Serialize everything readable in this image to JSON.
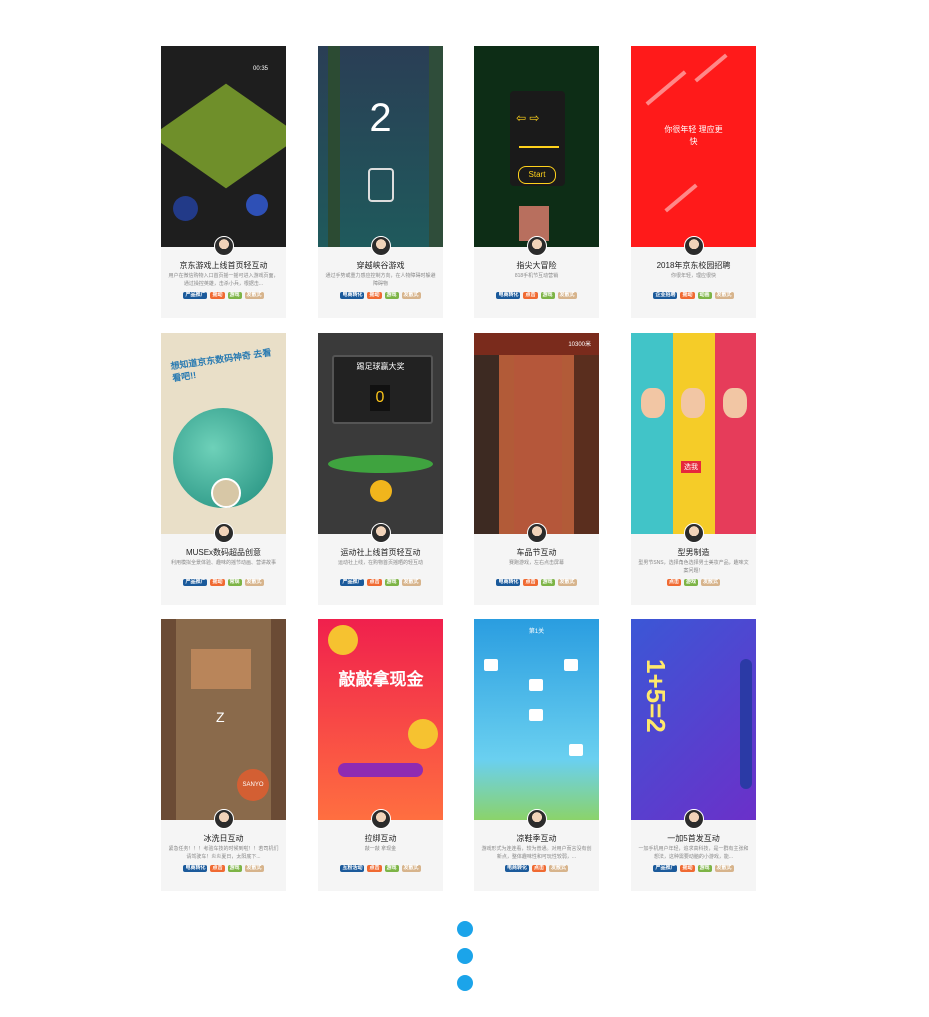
{
  "cards": [
    {
      "title": "京东游戏上线首页轻互动",
      "desc": "用户在微信购物入口首页摇一摇可进入游戏页面，通过操控英雄，击杀小兵，根据击...",
      "tags": [
        "产品推广",
        "摇动",
        "游戏",
        "发散式"
      ],
      "thumb_text": "00:35"
    },
    {
      "title": "穿越峡谷游戏",
      "desc": "通过手势或重力感应控制方向，在人物障碍时躲避障碍物",
      "tags": [
        "电商转化",
        "摇动",
        "游戏",
        "发散式"
      ],
      "thumb_text": "2"
    },
    {
      "title": "指尖大冒险",
      "desc": "818手机节互动营销",
      "tags": [
        "电商转化",
        "点击",
        "游戏",
        "发散式"
      ],
      "thumb_text": "Start"
    },
    {
      "title": "2018年京东校园招聘",
      "desc": "你很年轻，理应很快",
      "tags": [
        "企业招聘",
        "摇动",
        "动画",
        "发散式"
      ],
      "thumb_text": "你很年轻 理应更快"
    },
    {
      "title": "MUSEx数码超品创意",
      "desc": "利用模拟全景体验、趣味的摇节动画、营讲故事",
      "tags": [
        "产品推广",
        "摇动",
        "常规",
        "发散式"
      ],
      "thumb_text": "想知道京东数码神奇 去看看吧!!"
    },
    {
      "title": "运动社上线首页轻互动",
      "desc": "运动社上线，在购物首页摇晒的轻互动",
      "tags": [
        "产品推广",
        "点击",
        "游戏",
        "发散式"
      ],
      "thumb_text": "踢足球赢大奖"
    },
    {
      "title": "车品节互动",
      "desc": "赛跑游戏，左右点击屏幕",
      "tags": [
        "电商转化",
        "点击",
        "游戏",
        "发散式"
      ],
      "thumb_text": "10300米"
    },
    {
      "title": "型男制造",
      "desc": "型男节SNS，选择角色选择男士美妆产品，趣味文案问题！",
      "tags": [
        "点击",
        "游戏",
        "发散式"
      ],
      "thumb_text": "选我"
    },
    {
      "title": "冰洗日互动",
      "desc": "紧急任务！！！考验车技的时候到啦！！若司机们请驾驶车！炎炎夏日，太阳底下...",
      "tags": [
        "电商转化",
        "点击",
        "游戏",
        "发散式"
      ],
      "thumb_text": "SANYO"
    },
    {
      "title": "拉绑互动",
      "desc": "敲一敲 拿现金",
      "tags": [
        "互粉活动",
        "点击",
        "游戏",
        "发散式"
      ],
      "thumb_text": "敲敲拿现金"
    },
    {
      "title": "凉鞋季互动",
      "desc": "游戏形式为连连看，较为普通。对用户而言没有创新点，整体趣味性和可玩性较弱，...",
      "tags": [
        "电商转化",
        "点击",
        "发散式"
      ],
      "thumb_text": "第1关"
    },
    {
      "title": "一加5首发互动",
      "desc": "一加手机用户年轻，追求高科技，是一群有主张和想法，这种需要动脑的小游戏，能...",
      "tags": [
        "产品推广",
        "摇动",
        "游戏",
        "发散式"
      ],
      "thumb_text": "1+5=2"
    }
  ],
  "tag_colors": {
    "产品推广": "#1b5a9b",
    "电商转化": "#1b5a9b",
    "企业招聘": "#1b5a9b",
    "互粉活动": "#1b5a9b",
    "摇动": "#f06a32",
    "点击": "#f06a32",
    "游戏": "#7db446",
    "动画": "#7db446",
    "常规": "#7db446",
    "发散式": "#d7b48c"
  },
  "pagination": {
    "dots": 3,
    "color": "#1ba4ea"
  }
}
